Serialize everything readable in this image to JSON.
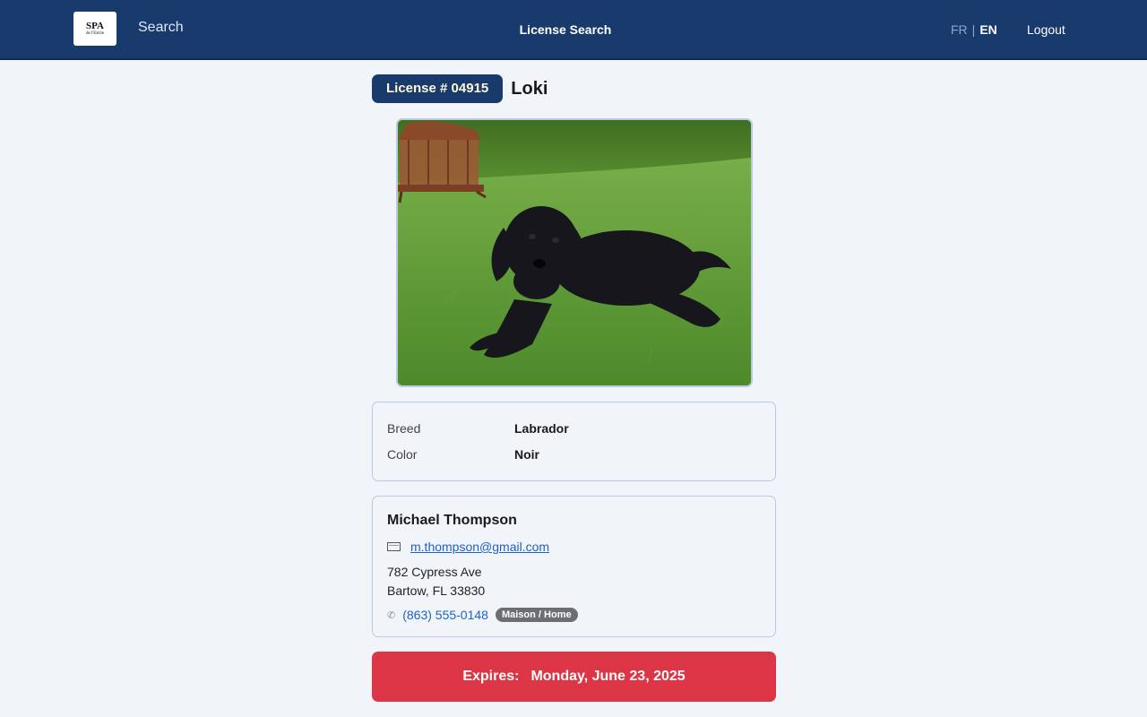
{
  "nav": {
    "logo_text": "SPA",
    "logo_sub": "de l'Estrie",
    "search_label": "Search",
    "title": "License Search",
    "lang_fr": "FR",
    "lang_sep": "|",
    "lang_en": "EN",
    "logout_label": "Logout"
  },
  "license": {
    "badge": "License # 04915",
    "dog_name": "Loki"
  },
  "details": {
    "breed_label": "Breed",
    "breed_value": "Labrador",
    "color_label": "Color",
    "color_value": "Noir"
  },
  "owner": {
    "name": "Michael Thompson",
    "email": "m.thompson@gmail.com",
    "address_line1": "782 Cypress Ave",
    "address_line2": "Bartow, FL 33830",
    "phone": "(863) 555-0148",
    "phone_type": "Maison / Home"
  },
  "expiry": {
    "label": "Expires:",
    "date": "Monday, June 23, 2025"
  },
  "colors": {
    "nav_bg": "#183a6c",
    "expires_bg": "#dc3545",
    "link": "#1b63c7"
  }
}
